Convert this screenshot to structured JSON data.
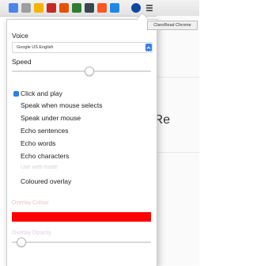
{
  "toolbar": {
    "extensions": [
      {
        "name": "extension-1-icon",
        "color": "#4a86e8"
      },
      {
        "name": "extension-2-icon",
        "color": "#9e9e9e"
      },
      {
        "name": "extension-3-icon",
        "color": "#f4b400"
      },
      {
        "name": "extension-4-icon",
        "color": "#c62828"
      },
      {
        "name": "extension-5-icon",
        "color": "#e65100"
      },
      {
        "name": "extension-6-icon",
        "color": "#2e7d32"
      },
      {
        "name": "extension-7-icon",
        "color": "#37474f"
      },
      {
        "name": "extension-8-icon",
        "color": "#ff5722"
      },
      {
        "name": "extension-9-icon",
        "color": "#1e88e5"
      },
      {
        "name": "claroread-icon",
        "color": "#0d47a1"
      },
      {
        "name": "menu-icon",
        "color": "#333333"
      }
    ],
    "tooltip": "ClaroRead Chrome"
  },
  "page": {
    "text": "Claro Re"
  },
  "popup": {
    "voice_label": "Voice",
    "voice_value": "Google US English",
    "speed_label": "Speed",
    "speed_value": 0.55,
    "options": [
      {
        "label": "Click and play",
        "checked": true
      },
      {
        "label": "Speak when mouse selects",
        "checked": false
      },
      {
        "label": "Speak under mouse",
        "checked": false
      },
      {
        "label": "Echo sentences",
        "checked": false
      },
      {
        "label": "Echo words",
        "checked": false
      },
      {
        "label": "Echo characters",
        "checked": false
      },
      {
        "label": "Use web mode",
        "checked": false,
        "disabled": true
      },
      {
        "label": "Coloured overlay",
        "checked": false
      }
    ],
    "overlay_colour_label": "Overlay Colour",
    "overlay_colour": "#ff0000",
    "overlay_opacity_label": "Overlay Opacity",
    "overlay_opacity_value": 0.06
  },
  "colors": {
    "accent": "#2f7fe6",
    "overlay": "#ff0000"
  }
}
